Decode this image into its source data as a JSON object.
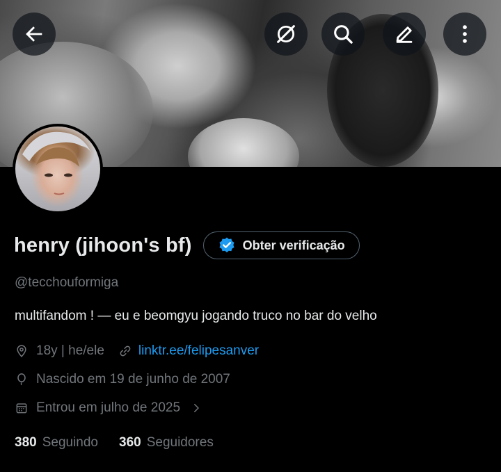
{
  "header": {
    "back_icon": "arrow-left-icon",
    "buttons": [
      "blocked-circle-icon",
      "search-icon",
      "edit-pencil-icon",
      "more-vertical-icon"
    ]
  },
  "profile": {
    "name": "henry (jihoon's bf)",
    "handle": "@tecchouformiga",
    "verification_button": "Obter verificação",
    "bio": "multifandom ! —  eu e beomgyu jogando truco no bar do velho",
    "location": "18y | he/ele",
    "website": "linktr.ee/felipesanver",
    "birthday": "Nascido em 19 de junho de 2007",
    "joined": "Entrou em julho de 2025"
  },
  "stats": {
    "following_count": "380",
    "following_label": "Seguindo",
    "followers_count": "360",
    "followers_label": "Seguidores"
  },
  "colors": {
    "background": "#000000",
    "text": "#e7e9ea",
    "secondary": "#71767b",
    "accent": "#1d9bf0"
  }
}
